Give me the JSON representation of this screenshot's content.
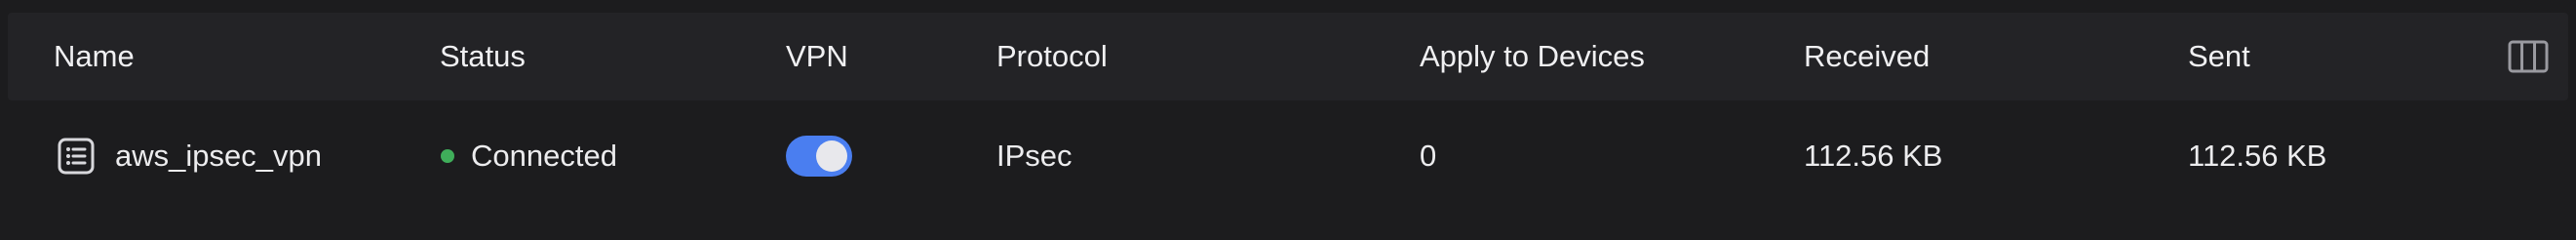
{
  "columns": {
    "name": "Name",
    "status": "Status",
    "vpn": "VPN",
    "protocol": "Protocol",
    "apply_to_devices": "Apply to Devices",
    "received": "Received",
    "sent": "Sent"
  },
  "rows": [
    {
      "name": "aws_ipsec_vpn",
      "status": "Connected",
      "vpn_enabled": true,
      "protocol": "IPsec",
      "apply_to_devices": "0",
      "received": "112.56 KB",
      "sent": "112.56 KB"
    }
  ],
  "icons": {
    "name_icon": "list-document-icon",
    "columns_button": "columns-icon"
  },
  "colors": {
    "background": "#1c1c1e",
    "header_background": "#232326",
    "status_connected": "#3fae5a",
    "toggle_on": "#4a7ef0"
  }
}
